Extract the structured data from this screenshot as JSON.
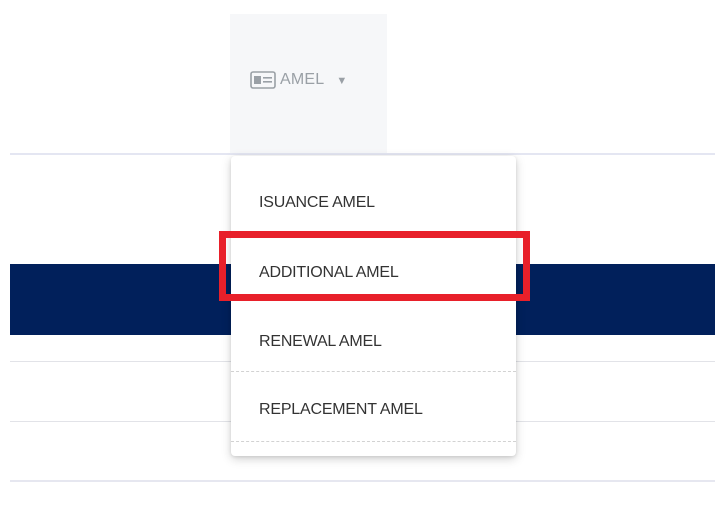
{
  "nav": {
    "label": "AMEL",
    "icon": "id-card-icon",
    "caret_icon": "caret-down-icon"
  },
  "dropdown": {
    "items": [
      {
        "label": "ISUANCE AMEL"
      },
      {
        "label": "ADDITIONAL AMEL"
      },
      {
        "label": "RENEWAL AMEL"
      },
      {
        "label": "REPLACEMENT AMEL"
      }
    ]
  },
  "highlight": {
    "target_item": "ADDITIONAL AMEL",
    "color": "#e8202a"
  },
  "colors": {
    "banner": "#01205b",
    "nav_text": "#9aa0a6",
    "menu_text": "#333333"
  }
}
